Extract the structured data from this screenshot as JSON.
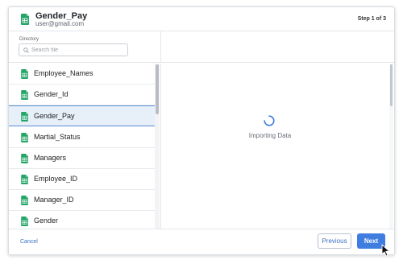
{
  "header": {
    "title": "Gender_Pay",
    "subtitle": "user@gmail.com",
    "step": "Step 1 of 3",
    "icon": "google-sheets-icon"
  },
  "directory": {
    "label": "Directory",
    "search_placeholder": "Search file",
    "search_value": ""
  },
  "files": [
    {
      "label": "Employee_Names",
      "selected": false
    },
    {
      "label": "Gender_Id",
      "selected": false
    },
    {
      "label": "Gender_Pay",
      "selected": true
    },
    {
      "label": "Martial_Status",
      "selected": false
    },
    {
      "label": "Managers",
      "selected": false
    },
    {
      "label": "Employee_ID",
      "selected": false
    },
    {
      "label": "Manager_ID",
      "selected": false
    },
    {
      "label": "Gender",
      "selected": false
    }
  ],
  "preview": {
    "loading_text": "Importing Data",
    "icon": "loading-spinner-icon"
  },
  "footer": {
    "cancel_label": "Cancel",
    "previous_label": "Previous",
    "next_label": "Next"
  },
  "colors": {
    "accent": "#3f7de0",
    "sheets_green": "#23a566",
    "selected_bg": "#e7eff9"
  }
}
